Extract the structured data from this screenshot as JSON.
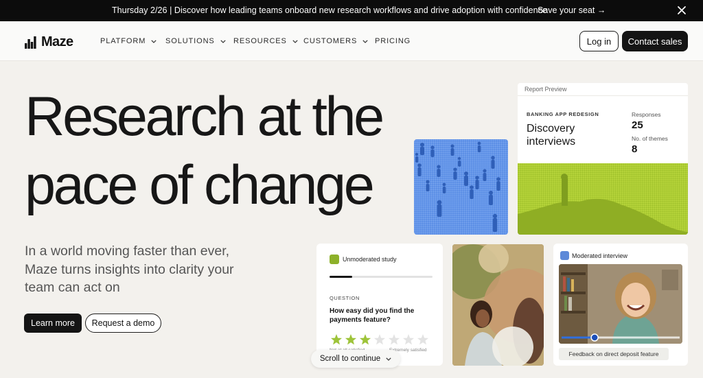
{
  "announcement": {
    "message": "Thursday 2/26 | Discover how leading teams onboard new research workflows and drive adoption with confidence",
    "cta": "Save your seat →"
  },
  "nav": {
    "logo_text": "Maze",
    "items": [
      {
        "label": "PLATFORM"
      },
      {
        "label": "SOLUTIONS"
      },
      {
        "label": "RESOURCES"
      },
      {
        "label": "CUSTOMERS"
      },
      {
        "label": "PRICING"
      }
    ],
    "login": "Log in",
    "contact": "Contact sales"
  },
  "hero": {
    "title_line1": "Research at the",
    "title_line2": "pace of change",
    "subtitle": "In a world moving faster than ever, Maze turns insights into clarity your team can act on",
    "primary_cta": "Learn more",
    "secondary_cta": "Request a demo"
  },
  "report_preview": {
    "label": "Report Preview",
    "project": "BANKING APP REDESIGN",
    "name": "Discovery interviews",
    "responses_label": "Responses",
    "responses_value": "25",
    "themes_label": "No. of themes",
    "themes_value": "8"
  },
  "study_card": {
    "tag": "Unmoderated study",
    "progress_fraction": 0.22,
    "question_label": "QUESTION",
    "question": "How easy did you find the payments feature?",
    "rating": 3,
    "rating_max": 7,
    "scale_low": "Not at all satisfied",
    "scale_high": "Extremely satisfied"
  },
  "moderated_card": {
    "tag": "Moderated interview",
    "playback_fraction": 0.28,
    "caption": "Feedback on direct deposit feature"
  },
  "scroll": {
    "label": "Scroll to continue"
  },
  "colors": {
    "accent_green": "#b6d43a",
    "tile_blue": "#5a8ee6",
    "star_filled": "#9ec43a",
    "star_empty": "#e3e3e3"
  }
}
